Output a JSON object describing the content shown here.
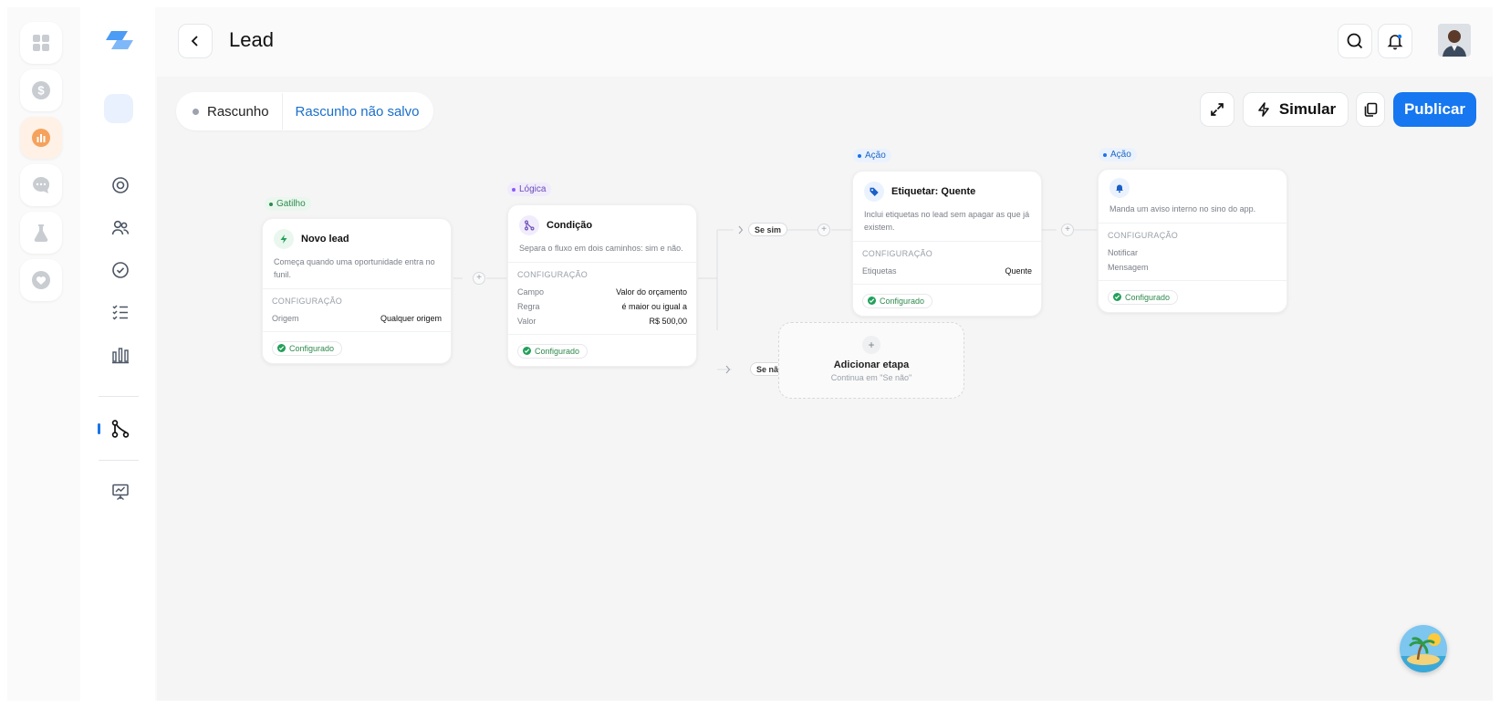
{
  "header": {
    "title": "Lead"
  },
  "toolbar": {
    "status": "Rascunho",
    "draft_status": "Rascunho não salvo",
    "simulate_label": "Simular",
    "publish_label": "Publicar"
  },
  "colors": {
    "accent": "#1677f0",
    "success": "#22a05a",
    "logic": "#8b5cf6",
    "draft": "#1a6fc9"
  },
  "nodes": [
    {
      "tag": "Gatilho",
      "title": "Novo lead",
      "icon": "lightning-icon",
      "description": "Começa quando uma oportunidade entra no funil.",
      "config_title": "CONFIGURAÇÃO",
      "config": [
        {
          "key": "Origem",
          "value": "Qualquer origem"
        }
      ],
      "status": "Configurado"
    },
    {
      "tag": "Lógica",
      "title": "Condição",
      "icon": "branch-icon",
      "description": "Separa o fluxo em dois caminhos: sim e não.",
      "config_title": "CONFIGURAÇÃO",
      "config": [
        {
          "key": "Campo",
          "value": "Valor do orçamento"
        },
        {
          "key": "Regra",
          "value": "é maior ou igual a"
        },
        {
          "key": "Valor",
          "value": "R$ 500,00"
        }
      ],
      "status": "Configurado"
    },
    {
      "tag": "Ação",
      "title": "Etiquetar: Quente",
      "icon": "tag-icon",
      "description": "Inclui etiquetas no lead sem apagar as que já existem.",
      "config_title": "CONFIGURAÇÃO",
      "config": [
        {
          "key": "Etiquetas",
          "value": "Quente"
        }
      ],
      "status": "Configurado"
    },
    {
      "tag": "Ação",
      "title": "",
      "icon": "bell-icon",
      "description": "Manda um aviso interno no sino do app.",
      "config_title": "CONFIGURAÇÃO",
      "config": [
        {
          "key": "Notificar",
          "value": ""
        },
        {
          "key": "Mensagem",
          "value": ""
        }
      ],
      "status": "Configurado"
    }
  ],
  "branches": {
    "yes": "Se sim",
    "no": "Se não",
    "plus": "+"
  },
  "add_step": {
    "title": "Adicionar etapa",
    "subtitle": "Continua em \"Se não\"",
    "plus": "+"
  }
}
